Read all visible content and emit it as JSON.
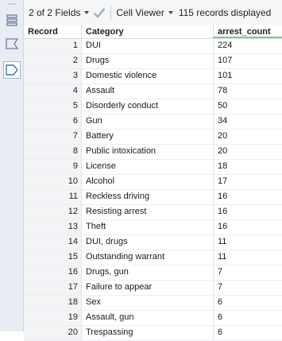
{
  "toolbar": {
    "fields_label": "2 of 2 Fields",
    "viewer_label": "Cell Viewer",
    "records_label": "115 records displayed"
  },
  "columns": {
    "record": "Record",
    "category": "Category",
    "count": "arrest_count"
  },
  "rows": [
    {
      "record": "1",
      "category": "DUI",
      "count": "224"
    },
    {
      "record": "2",
      "category": "Drugs",
      "count": "107"
    },
    {
      "record": "3",
      "category": "Domestic violence",
      "count": "101"
    },
    {
      "record": "4",
      "category": "Assault",
      "count": "78"
    },
    {
      "record": "5",
      "category": "Disorderly conduct",
      "count": "50"
    },
    {
      "record": "6",
      "category": "Gun",
      "count": "34"
    },
    {
      "record": "7",
      "category": "Battery",
      "count": "20"
    },
    {
      "record": "8",
      "category": "Public intoxication",
      "count": "20"
    },
    {
      "record": "9",
      "category": "License",
      "count": "18"
    },
    {
      "record": "10",
      "category": "Alcohol",
      "count": "17"
    },
    {
      "record": "11",
      "category": "Reckless driving",
      "count": "16"
    },
    {
      "record": "12",
      "category": "Resisting arrest",
      "count": "16"
    },
    {
      "record": "13",
      "category": "Theft",
      "count": "16"
    },
    {
      "record": "14",
      "category": "DUI, drugs",
      "count": "11"
    },
    {
      "record": "15",
      "category": "Outstanding warrant",
      "count": "11"
    },
    {
      "record": "16",
      "category": "Drugs, gun",
      "count": "7"
    },
    {
      "record": "17",
      "category": "Failure to appear",
      "count": "7"
    },
    {
      "record": "18",
      "category": "Sex",
      "count": "6"
    },
    {
      "record": "19",
      "category": "Assault, gun",
      "count": "6"
    },
    {
      "record": "20",
      "category": "Trespassing",
      "count": "6"
    }
  ],
  "colors": {
    "accent": "#7fc97f",
    "sidebar": "#e9ecf3",
    "record_col": "#f3f4f6"
  },
  "icons": [
    "list-icon",
    "input-anchor-icon",
    "output-anchor-icon",
    "check-icon"
  ]
}
